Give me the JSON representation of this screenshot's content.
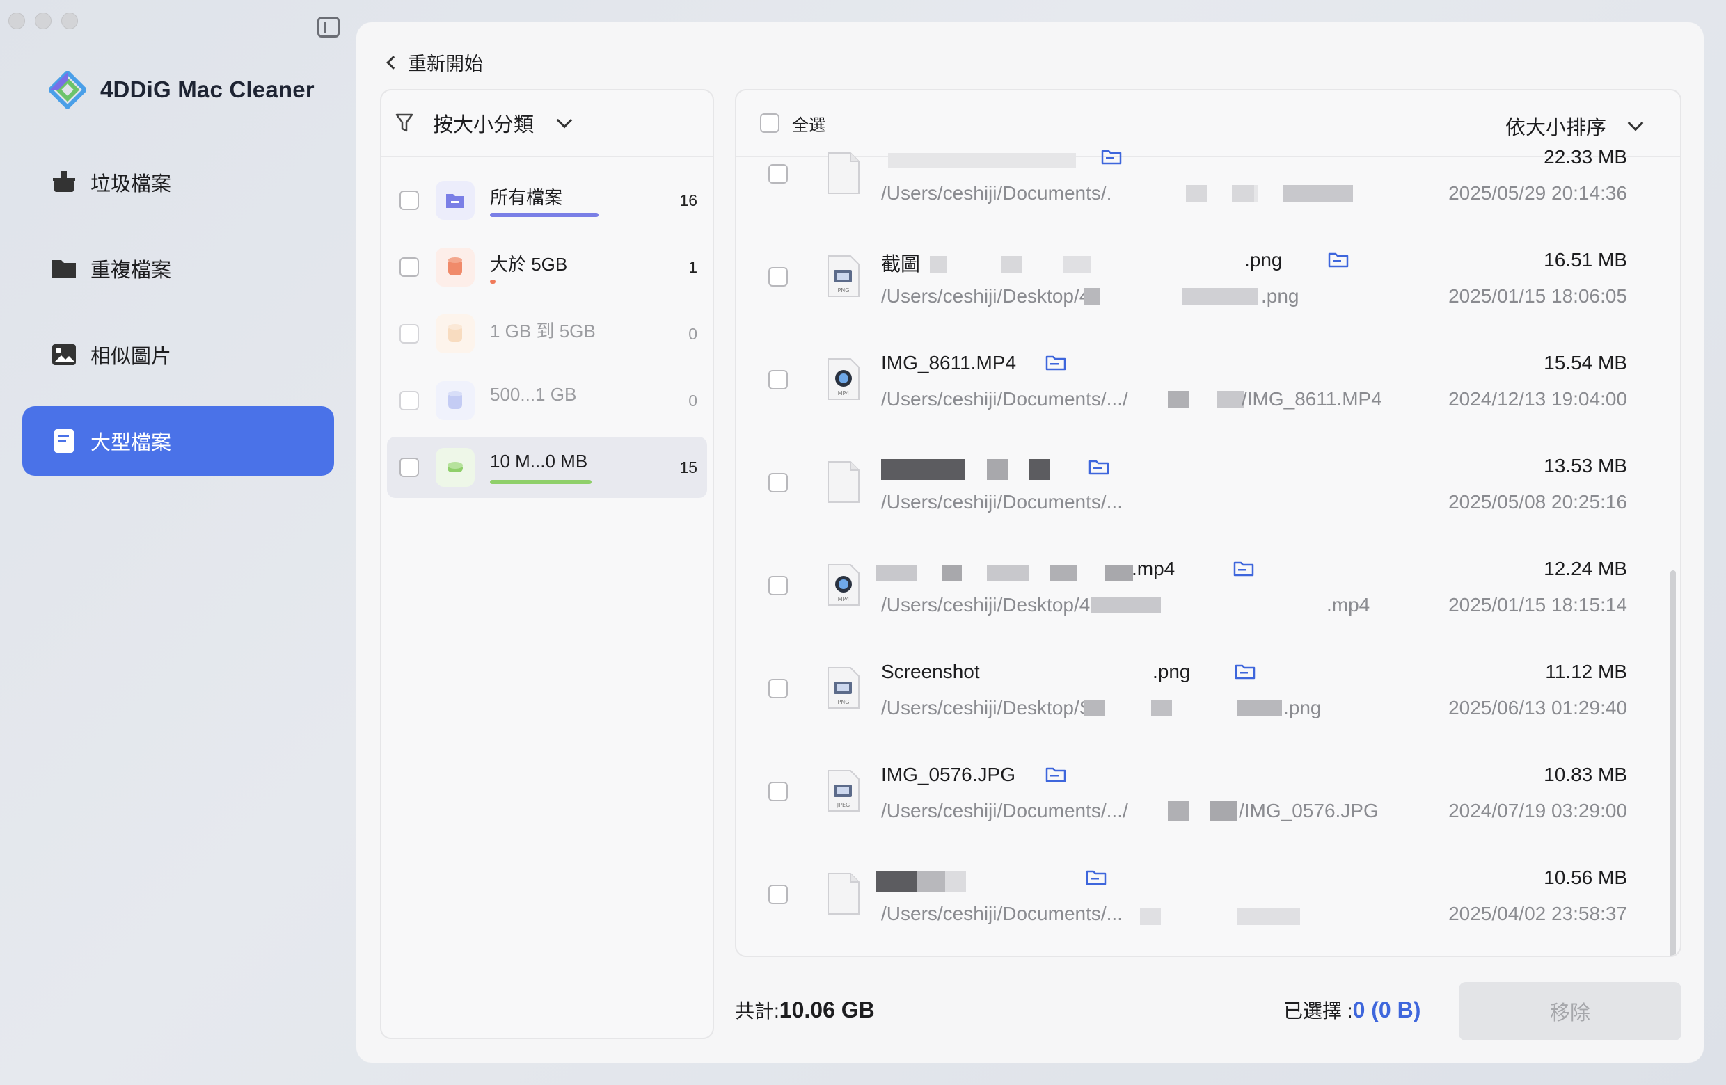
{
  "app": {
    "title": "4DDiG Mac Cleaner"
  },
  "nav": {
    "items": [
      {
        "label": "垃圾檔案",
        "icon": "broom-icon"
      },
      {
        "label": "重複檔案",
        "icon": "folder-icon"
      },
      {
        "label": "相似圖片",
        "icon": "image-icon"
      },
      {
        "label": "大型檔案",
        "icon": "document-icon",
        "active": true
      }
    ]
  },
  "header": {
    "back_label": "重新開始"
  },
  "filter": {
    "label": "按大小分類",
    "categories": [
      {
        "label": "所有檔案",
        "count": "16",
        "color": "#7a7fe6",
        "bar": 0.62
      },
      {
        "label": "大於 5GB",
        "count": "1",
        "color": "#f08a6a",
        "bar": 0.04
      },
      {
        "label": "1 GB 到 5GB",
        "count": "0",
        "color": "#f5c79a",
        "bar": 0
      },
      {
        "label": "500...1 GB",
        "count": "0",
        "color": "#a9b4f0",
        "bar": 0
      },
      {
        "label": "10 M...0 MB",
        "count": "15",
        "color": "#8fcf6a",
        "bar": 0.58,
        "active": true
      }
    ]
  },
  "list": {
    "select_all_label": "全選",
    "sort_label": "依大小排序",
    "files": [
      {
        "name": "",
        "path": "/Users/ceshiji/Documents/.",
        "size": "22.33  MB",
        "date": "2025/05/29 20:14:36",
        "type": "generic"
      },
      {
        "name": "截圖",
        "name_suffix": ".png",
        "path": "/Users/ceshiji/Desktop/4",
        "path_suffix": ".png",
        "size": "16.51  MB",
        "date": "2025/01/15 18:06:05",
        "type": "png"
      },
      {
        "name": "IMG_8611.MP4",
        "path": "/Users/ceshiji/Documents/.../",
        "path_suffix": "/IMG_8611.MP4",
        "size": "15.54  MB",
        "date": "2024/12/13 19:04:00",
        "type": "mp4"
      },
      {
        "name": "",
        "path": "/Users/ceshiji/Documents/...",
        "size": "13.53  MB",
        "date": "2025/05/08 20:25:16",
        "type": "generic"
      },
      {
        "name": "",
        "name_suffix": ".mp4",
        "path": "/Users/ceshiji/Desktop/4",
        "path_suffix": ".mp4",
        "size": "12.24  MB",
        "date": "2025/01/15 18:15:14",
        "type": "mp4"
      },
      {
        "name": "Screenshot",
        "name_suffix": ".png",
        "path": "/Users/ceshiji/Desktop/S",
        "path_suffix": ".png",
        "size": "11.12  MB",
        "date": "2025/06/13 01:29:40",
        "type": "png"
      },
      {
        "name": "IMG_0576.JPG",
        "path": "/Users/ceshiji/Documents/.../",
        "path_suffix": "/IMG_0576.JPG",
        "size": "10.83  MB",
        "date": "2024/07/19 03:29:00",
        "type": "jpeg"
      },
      {
        "name": "",
        "path": "/Users/ceshiji/Documents/...",
        "size": "10.56  MB",
        "date": "2025/04/02 23:58:37",
        "type": "generic"
      }
    ]
  },
  "footer": {
    "total_label": "共計:",
    "total_value": "10.06 GB",
    "selected_label": "已選擇 :",
    "selected_value": "0 (0  B)",
    "remove_label": "移除"
  },
  "colors": {
    "accent": "#4a72e8",
    "selected_blue": "#3e66dc"
  }
}
